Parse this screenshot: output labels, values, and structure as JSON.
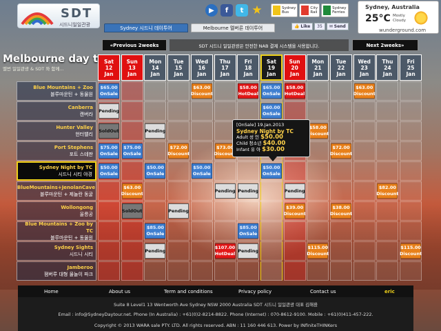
{
  "header": {
    "logo_main": "SDT",
    "logo_sub": "시드니일일관광",
    "icons": [
      "play-icon",
      "facebook-icon",
      "twitter-icon",
      "star-icon"
    ],
    "transport": [
      {
        "label": "Sydney\nBus",
        "color": "#f0c419"
      },
      {
        "label": "City\nRail",
        "color": "#e23b2e"
      },
      {
        "label": "Sydney\nFerries",
        "color": "#1f8a3a"
      }
    ],
    "tabs": [
      "Sydney 시드니 데이투어",
      "Melbourne 멜버른 데이투어"
    ],
    "like_label": "Like",
    "like_count": "35",
    "send_label": "Send"
  },
  "weather": {
    "city": "Sydney, Australia",
    "temp": "25°C",
    "condition": "Mostly\nCloudy",
    "provider": "wunderground.com"
  },
  "page": {
    "title": "Melbourne day to",
    "subtitle": "멜번 일일관광 & SDT 와 함께..."
  },
  "nav": {
    "prev": "«Previous 2weeks",
    "notice": "SDT 시드니 일일관광은 안전한 NAB 결제 시스템을 사용합니다.",
    "next": "Next 2weeks»"
  },
  "dates": [
    {
      "dow": "Sat",
      "day": "12",
      "mon": "Jan",
      "type": "wkend"
    },
    {
      "dow": "Sun",
      "day": "13",
      "mon": "Jan",
      "type": "wkend"
    },
    {
      "dow": "Mon",
      "day": "14",
      "mon": "Jan",
      "type": "wk"
    },
    {
      "dow": "Tue",
      "day": "15",
      "mon": "Jan",
      "type": "wk"
    },
    {
      "dow": "Wed",
      "day": "16",
      "mon": "Jan",
      "type": "wk"
    },
    {
      "dow": "Thu",
      "day": "17",
      "mon": "Jan",
      "type": "wk"
    },
    {
      "dow": "Fri",
      "day": "18",
      "mon": "Jan",
      "type": "wk"
    },
    {
      "dow": "Sat",
      "day": "19",
      "mon": "Jan",
      "type": "today"
    },
    {
      "dow": "Sun",
      "day": "20",
      "mon": "Jan",
      "type": "wkend"
    },
    {
      "dow": "Mon",
      "day": "21",
      "mon": "Jan",
      "type": "wk"
    },
    {
      "dow": "Tue",
      "day": "22",
      "mon": "Jan",
      "type": "wk"
    },
    {
      "dow": "Wed",
      "day": "23",
      "mon": "Jan",
      "type": "wk"
    },
    {
      "dow": "Thu",
      "day": "24",
      "mon": "Jan",
      "type": "wk"
    },
    {
      "dow": "Fri",
      "day": "25",
      "mon": "Jan",
      "type": "wk"
    }
  ],
  "tours": [
    {
      "en": "Blue Mountains + Zoo",
      "kr": "블루마운틴 + 동물원",
      "cells": [
        {
          "col": 0,
          "status": "onsale",
          "price": "$65.00",
          "label": "OnSale"
        },
        {
          "col": 4,
          "status": "discount",
          "price": "$63.00",
          "label": "Discount"
        },
        {
          "col": 6,
          "status": "hotdeal",
          "price": "$58.00",
          "label": "HotDeal"
        },
        {
          "col": 7,
          "status": "onsale",
          "price": "$65.00",
          "label": "OnSale"
        },
        {
          "col": 8,
          "status": "hotdeal",
          "price": "$58.00",
          "label": "HotDeal"
        },
        {
          "col": 11,
          "status": "discount",
          "price": "$63.00",
          "label": "Discount"
        }
      ]
    },
    {
      "en": "Canberra",
      "kr": "캔버라",
      "cells": [
        {
          "col": 0,
          "status": "pending",
          "price": "Pending",
          "label": "Pending"
        },
        {
          "col": 7,
          "status": "onsale",
          "price": "$60.00",
          "label": "OnSale"
        }
      ]
    },
    {
      "en": "Hunter Valley",
      "kr": "헌터밸리",
      "cells": [
        {
          "col": 0,
          "status": "soldout",
          "price": "SoldOut",
          "label": "SoldOut"
        },
        {
          "col": 2,
          "status": "pending",
          "price": "Pending",
          "label": "Pending"
        },
        {
          "col": 9,
          "status": "discount",
          "price": "$58.00",
          "label": "Discount"
        }
      ]
    },
    {
      "en": "Port Stephens",
      "kr": "포트 스테판",
      "cells": [
        {
          "col": 0,
          "status": "onsale",
          "price": "$75.00",
          "label": "OnSale"
        },
        {
          "col": 1,
          "status": "onsale",
          "price": "$75.00",
          "label": "OnSale"
        },
        {
          "col": 3,
          "status": "discount",
          "price": "$72.00",
          "label": "Discount"
        },
        {
          "col": 5,
          "status": "discount",
          "price": "$73.00",
          "label": "Discount"
        },
        {
          "col": 10,
          "status": "discount",
          "price": "$72.00",
          "label": "Discount"
        }
      ]
    },
    {
      "en": "Sydney Night by TC",
      "kr": "시드니 시티 야경",
      "selected": true,
      "cells": [
        {
          "col": 0,
          "status": "onsale",
          "price": "$50.00",
          "label": "OnSale"
        },
        {
          "col": 2,
          "status": "onsale",
          "price": "$50.00",
          "label": "OnSale"
        },
        {
          "col": 4,
          "status": "onsale",
          "price": "$50.00",
          "label": "OnSale"
        },
        {
          "col": 7,
          "status": "onsale",
          "price": "$50.00",
          "label": "OnSale"
        }
      ]
    },
    {
      "en": "BlueMountains+JenolanCave",
      "kr": "블루마운틴 + 제놀란 동굴",
      "cells": [
        {
          "col": 1,
          "status": "discount",
          "price": "$63.00",
          "label": "Discount"
        },
        {
          "col": 5,
          "status": "pending",
          "price": "Pending",
          "label": "Pending"
        },
        {
          "col": 6,
          "status": "pending",
          "price": "Pending",
          "label": "Pending"
        },
        {
          "col": 8,
          "status": "pending",
          "price": "Pending",
          "label": "Pending"
        },
        {
          "col": 12,
          "status": "discount",
          "price": "$82.00",
          "label": "Discount"
        }
      ]
    },
    {
      "en": "Wollongong",
      "kr": "울릉공",
      "cells": [
        {
          "col": 1,
          "status": "soldout",
          "price": "SoldOut",
          "label": "SoldOut"
        },
        {
          "col": 3,
          "status": "pending",
          "price": "Pending",
          "label": "Pending"
        },
        {
          "col": 8,
          "status": "discount",
          "price": "$39.00",
          "label": "Discount"
        },
        {
          "col": 10,
          "status": "discount",
          "price": "$38.00",
          "label": "Discount"
        }
      ]
    },
    {
      "en": "Blue Mountains + Zoo by TC",
      "kr": "블루마운틴 + 동물원",
      "cells": [
        {
          "col": 2,
          "status": "onsale",
          "price": "$85.00",
          "label": "OnSale"
        },
        {
          "col": 6,
          "status": "onsale",
          "price": "$85.00",
          "label": "OnSale"
        }
      ]
    },
    {
      "en": "Sydney Sights",
      "kr": "시드니 시티",
      "cells": [
        {
          "col": 2,
          "status": "pending",
          "price": "Pending",
          "label": "Pending"
        },
        {
          "col": 5,
          "status": "hotdeal",
          "price": "$107.00",
          "label": "HotDeal"
        },
        {
          "col": 6,
          "status": "pending",
          "price": "Pending",
          "label": "Pending"
        },
        {
          "col": 9,
          "status": "discount",
          "price": "$115.00",
          "label": "Discount"
        },
        {
          "col": 13,
          "status": "discount",
          "price": "$115.00",
          "label": "Discount"
        }
      ]
    },
    {
      "en": "Jamberoo",
      "kr": "잼버루 대형 물놀이 파크",
      "cells": []
    }
  ],
  "tooltip": {
    "header": "[OnSale] 19.Jan.2013",
    "title": "Sydney Night by TC",
    "adult_label": "Adult 성  인",
    "adult": "$50.00",
    "child_label": "Child 청소년",
    "child": "$40.00",
    "infant_label": "Infant 유  아",
    "infant": "$30.00"
  },
  "footer": {
    "links": [
      "Home",
      "About us",
      "Term and conditions",
      "Privacy policy",
      "Contact us"
    ],
    "user": "eric",
    "address": "Suite 8 Level1 13 Wentworth Ave Sydney NSW 2000 Australia SDT 시드니 일일관광 대표 김해환",
    "contact": "Email : info@SydneyDaytour.net. Phone (In Australia) : +61(0)2-8214-8822. Phone (Internet) : 070-8612-9100. Mobile : +61(0)411-457-222.",
    "copyright": "Copyright © 2013 WARA sale PTY. LTD. All rights reserved. ABN : 11 160 446 613. Power by INfiniteTHINKers"
  },
  "colors": {
    "onsale": "#3f7fd0",
    "discount": "#e8801a",
    "hotdeal": "#e21818",
    "pending": "#dcdcdc",
    "soldout": "#777777",
    "weekend": "#e01010",
    "accent": "#f0d21a"
  }
}
